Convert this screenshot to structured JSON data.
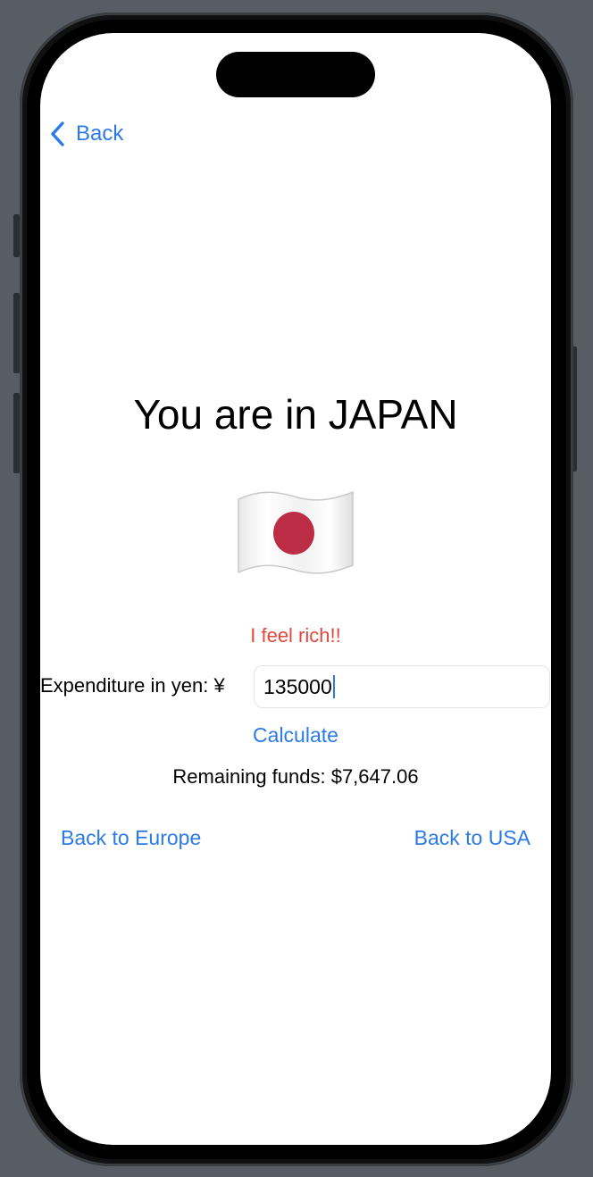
{
  "nav": {
    "back_label": "Back",
    "back_icon": "chevron-left-icon"
  },
  "main": {
    "title": "You are in JAPAN",
    "flag_icon": "japan-flag-icon",
    "mood_text": "I feel rich!!",
    "expenditure_label": "Expenditure in yen: ¥",
    "expenditure_value": "135000",
    "calculate_label": "Calculate",
    "remaining_text": "Remaining funds: $7,647.06",
    "back_europe_label": "Back to Europe",
    "back_usa_label": "Back to USA"
  },
  "colors": {
    "accent": "#2c7ae5",
    "mood": "#e2463c",
    "flag_circle": "#bc2c45",
    "device_background": "#585d65"
  }
}
